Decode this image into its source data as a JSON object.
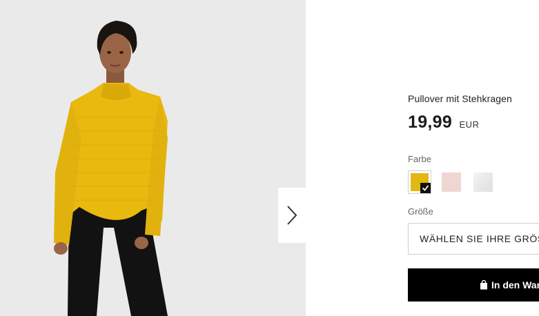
{
  "product": {
    "title": "Pullover mit Stehkragen",
    "price": "19,99",
    "currency": "EUR"
  },
  "gallery": {
    "image_alt": "Model in yellow turtleneck sweater and black trousers",
    "next_icon": "chevron-right-icon"
  },
  "color": {
    "label": "Farbe",
    "swatches": [
      {
        "name": "yellow",
        "hex": "#e3b812",
        "selected": true
      },
      {
        "name": "light-pink",
        "hex": "#f0d6d2",
        "selected": false
      },
      {
        "name": "light-grey",
        "hex": "#e8e8e8",
        "selected": false
      }
    ]
  },
  "size": {
    "label": "Größe",
    "placeholder": "WÄHLEN SIE IHRE GRÖSSE"
  },
  "cart": {
    "label": "In den Warenkorb",
    "icon": "shopping-bag-icon"
  },
  "colors": {
    "accent": "#000000",
    "sweater": "#e8b90f",
    "background_photo": "#eaeaea"
  }
}
